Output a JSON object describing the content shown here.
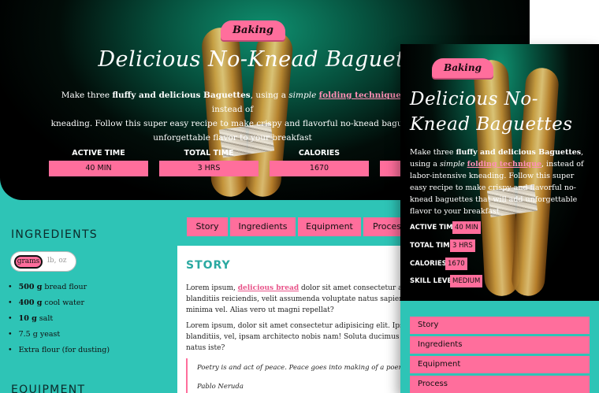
{
  "category_badge": "Baking",
  "title": "Delicious No-Knead Baguettes",
  "intro": {
    "t1": "Make three ",
    "b1": "fluffy and delicious Baguettes",
    "t2": ", using a ",
    "i1": "simple",
    "link": "folding technique",
    "t3": ", instead of labor-intensive kneading. Follow this super easy recipe to make crispy and flavorful no-knead baguettes that will add unforgettable flavor to your breakfast"
  },
  "desktop_intro": {
    "line1_t": ", instead of",
    "line2": "kneading. Follow this super easy recipe to make crispy and flavorful no-knead baguett",
    "line3": "unforgettable flavor to your breakfast"
  },
  "stats": [
    {
      "label": "ACTIVE TIME",
      "value": "40 MIN"
    },
    {
      "label": "TOTAL TIME",
      "value": "3 HRS"
    },
    {
      "label": "CALORIES",
      "value": "1670"
    },
    {
      "label": "SKILL LEVEL",
      "value": "MEDIUM"
    }
  ],
  "sidebar": {
    "ingredients_heading": "INGREDIENTS",
    "equipment_heading": "EQUIPMENT",
    "units": {
      "active": "grams",
      "inactive": "lb, oz"
    },
    "ingredients": [
      {
        "qty": "500 g",
        "name": " bread flour"
      },
      {
        "qty": "400 g",
        "name": " cool water"
      },
      {
        "qty": "10 g",
        "name": " salt"
      },
      {
        "qty": "",
        "name": "7.5 g yeast"
      },
      {
        "qty": "",
        "name": "Extra flour (for dusting)"
      }
    ]
  },
  "tabs": [
    "Story",
    "Ingredients",
    "Equipment",
    "Process"
  ],
  "desktop_tab_last": "Proces",
  "story": {
    "heading": "STORY",
    "p1_a": "Lorem ipsum, ",
    "p1_link": "delicious bread",
    "p1_b": " dolor sit amet consectetur adipisicin",
    "p1_line2": "blanditiis reiciendis, velit assumenda voluptate natus sapiente obcae",
    "p1_line3": "minima vel. Alias vero ut magni repellat?",
    "p2_line1": "Lorem ipsum, dolor sit amet consectetur adipisicing elit. Ipsum fugi",
    "p2_line2": "blanditiis, vel, ipsam architecto nobis nam! Soluta ducimus at pariatur asperi",
    "p2_line3": "natus iste?",
    "quote": "Poetry is and act of peace. Peace goes into making of a poem as flour go",
    "quote_author": "Pablo Neruda"
  },
  "colors": {
    "accent": "#ff6e9c",
    "teal": "#2ec4b6",
    "heading_teal": "#2aa9a1",
    "dark": "#000000"
  }
}
